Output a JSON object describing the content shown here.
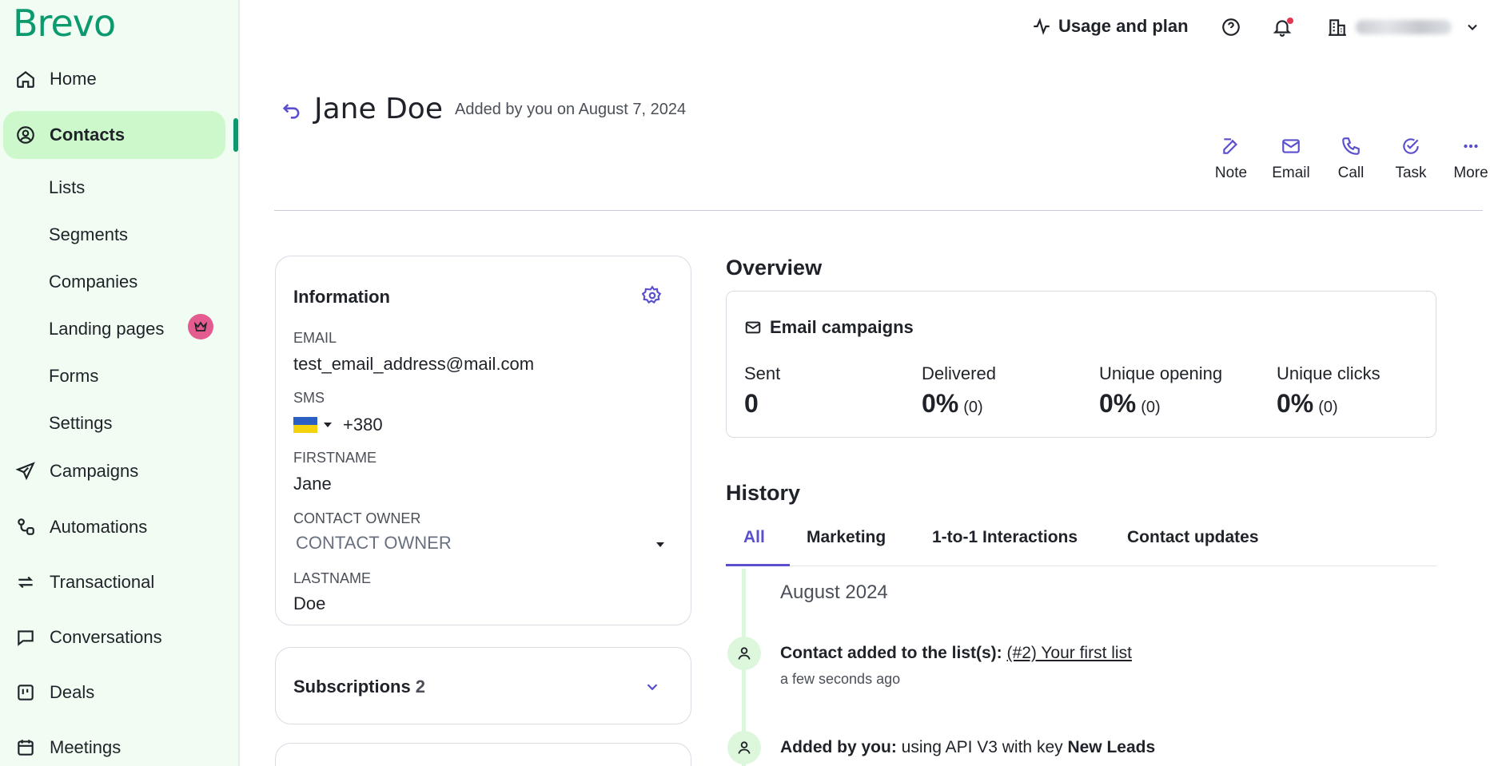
{
  "app": {
    "logo": "Brevo"
  },
  "sidebar": {
    "items": [
      {
        "label": "Home",
        "icon": "home-icon"
      },
      {
        "label": "Contacts",
        "icon": "contacts-icon",
        "active": true
      },
      {
        "label": "Campaigns",
        "icon": "paper-plane-icon"
      },
      {
        "label": "Automations",
        "icon": "automation-icon"
      },
      {
        "label": "Transactional",
        "icon": "arrows-icon"
      },
      {
        "label": "Conversations",
        "icon": "chat-icon"
      },
      {
        "label": "Deals",
        "icon": "board-icon"
      },
      {
        "label": "Meetings",
        "icon": "calendar-icon"
      }
    ],
    "sub_items": [
      "Lists",
      "Segments",
      "Companies",
      "Landing pages",
      "Forms",
      "Settings"
    ]
  },
  "topbar": {
    "usage_label": "Usage and plan",
    "help_icon": "help-icon",
    "bell_icon": "bell-icon",
    "account_icon": "building-icon"
  },
  "contact": {
    "name": "Jane Doe",
    "added_by": "Added by you on August 7, 2024"
  },
  "actions": [
    "Note",
    "Email",
    "Call",
    "Task",
    "More"
  ],
  "information": {
    "title": "Information",
    "fields": {
      "email_label": "EMAIL",
      "email_value": "test_email_address@mail.com",
      "sms_label": "SMS",
      "sms_value": "+380",
      "firstname_label": "FIRSTNAME",
      "firstname_value": "Jane",
      "owner_label": "CONTACT OWNER",
      "owner_placeholder": "CONTACT OWNER",
      "lastname_label": "LASTNAME",
      "lastname_value": "Doe"
    }
  },
  "subscriptions": {
    "title": "Subscriptions",
    "count": "2"
  },
  "overview": {
    "title": "Overview",
    "card_title": "Email campaigns",
    "stats": [
      {
        "label": "Sent",
        "value": "0",
        "sub": ""
      },
      {
        "label": "Delivered",
        "value": "0%",
        "sub": "(0)"
      },
      {
        "label": "Unique opening",
        "value": "0%",
        "sub": "(0)"
      },
      {
        "label": "Unique clicks",
        "value": "0%",
        "sub": "(0)"
      }
    ]
  },
  "history": {
    "title": "History",
    "tabs": [
      "All",
      "Marketing",
      "1-to-1 Interactions",
      "Contact updates"
    ],
    "month": "August 2024",
    "events": [
      {
        "bold": "Contact added to the list(s):",
        "link": "(#2) Your first list",
        "time": "a few seconds ago"
      },
      {
        "bold": "Added by you:",
        "text": " using API V3 with key ",
        "bold2": "New Leads"
      }
    ]
  },
  "colors": {
    "brand": "#0b996e",
    "accent": "#5a4fcf",
    "sidebar_bg": "#f1fdf2",
    "active_bg": "#cdf8cb",
    "badge": "#e35b8f"
  }
}
